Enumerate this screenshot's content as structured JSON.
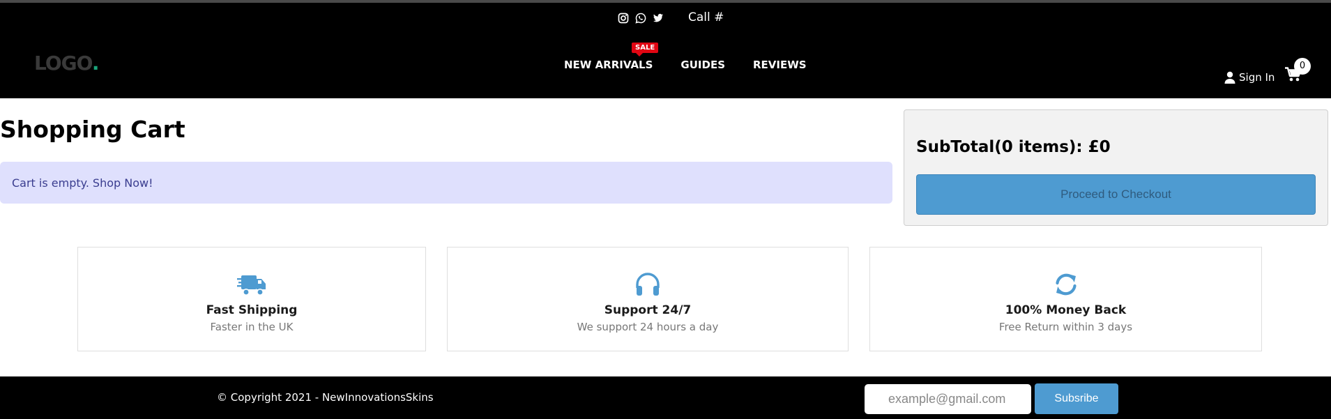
{
  "topbar": {
    "social_icons": [
      "instagram-icon",
      "whatsapp-icon",
      "twitter-icon"
    ],
    "call_label": "Call #"
  },
  "header": {
    "logo_text": "LOGO",
    "logo_dot": ".",
    "nav": [
      {
        "label": "NEW ARRIVALS",
        "badge": "SALE"
      },
      {
        "label": "GUIDES"
      },
      {
        "label": "REVIEWS"
      }
    ],
    "signin_label": "Sign In",
    "cart_count": "0"
  },
  "main": {
    "title": "Shopping Cart",
    "empty_message": "Cart is empty.",
    "shop_now_link": "Shop Now!"
  },
  "summary": {
    "subtotal_text": "SubTotal(0 items): £0",
    "checkout_label": "Proceed to Checkout"
  },
  "features": [
    {
      "icon": "truck-icon",
      "title": "Fast Shipping",
      "subtitle": "Faster in the UK"
    },
    {
      "icon": "headphones-icon",
      "title": "Support 24/7",
      "subtitle": "We support 24 hours a day"
    },
    {
      "icon": "refresh-icon",
      "title": "100% Money Back",
      "subtitle": "Free Return within 3 days"
    }
  ],
  "footer": {
    "copyright": "© Copyright 2021 - NewInnovationsSkins",
    "email_placeholder": "example@gmail.com",
    "subscribe_label": "Subsribe"
  },
  "colors": {
    "accent_blue": "#4e9bd1",
    "sale_red": "#e10613",
    "alert_bg": "#dfe0fd",
    "logo_dot": "#1aa37a"
  }
}
